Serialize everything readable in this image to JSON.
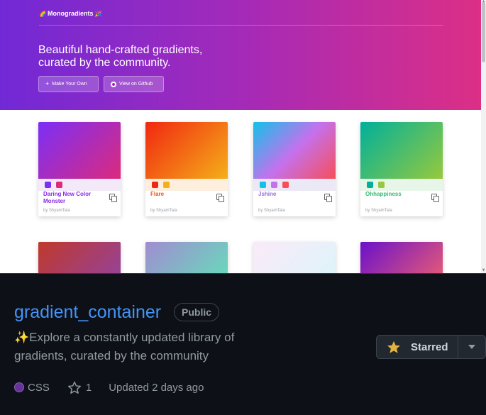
{
  "preview": {
    "brand": {
      "emoji_left": "🌈",
      "name": "Monogradients",
      "emoji_right": "🎉"
    },
    "headline_line1": "Beautiful hand-crafted gradients,",
    "headline_line2": "curated by the community.",
    "make_own_label": "Make Your Own",
    "make_own_icon": "+",
    "github_label": "View on Github",
    "colors": {
      "hero_start": "#7129d6",
      "hero_end": "#dc2f86"
    },
    "cards": [
      {
        "name": "Daring New Color Monster",
        "author": "by ShyamTala",
        "gradient": [
          "#7b2ff7",
          "#dc2a7c"
        ],
        "dots": [
          "#7b2ff7",
          "#dc2a7c"
        ],
        "tint": "#f3e9f8",
        "name_color": "#8a2be2"
      },
      {
        "name": "Flare",
        "author": "by ShyamTala",
        "gradient": [
          "#f12711",
          "#f5af19"
        ],
        "dots": [
          "#f12711",
          "#f5af19"
        ],
        "tint": "#fdeede",
        "name_color": "#f0531c"
      },
      {
        "name": "Jshine",
        "author": "by ShyamTala",
        "gradient": [
          "#12c2e9",
          "#c471ed",
          "#f64f59"
        ],
        "dots": [
          "#12c2e9",
          "#c471ed",
          "#f64f59"
        ],
        "tint": "#ece9f6",
        "name_color": "#9b6dd8"
      },
      {
        "name": "Ohhappiness",
        "author": "by ShyamTala",
        "gradient": [
          "#00b09b",
          "#96c93d"
        ],
        "dots": [
          "#00b09b",
          "#96c93d"
        ],
        "tint": "#e8f6e9",
        "name_color": "#3eb874"
      }
    ],
    "row2_gradients": [
      [
        "#c0392b",
        "#8e44ad"
      ],
      [
        "#a18cd1",
        "#5ee7b8"
      ],
      [
        "#fbeaf8",
        "#d8f6fb"
      ],
      [
        "#6a11cb",
        "#fc6767"
      ]
    ]
  },
  "repo": {
    "name": "gradient_container",
    "visibility": "Public",
    "description_line1": "✨Explore a constantly updated library of",
    "description_line2": "gradients, curated by the community",
    "star_label": "Starred",
    "language": "CSS",
    "language_color": "#663399",
    "stars": "1",
    "updated": "Updated 2 days ago"
  }
}
